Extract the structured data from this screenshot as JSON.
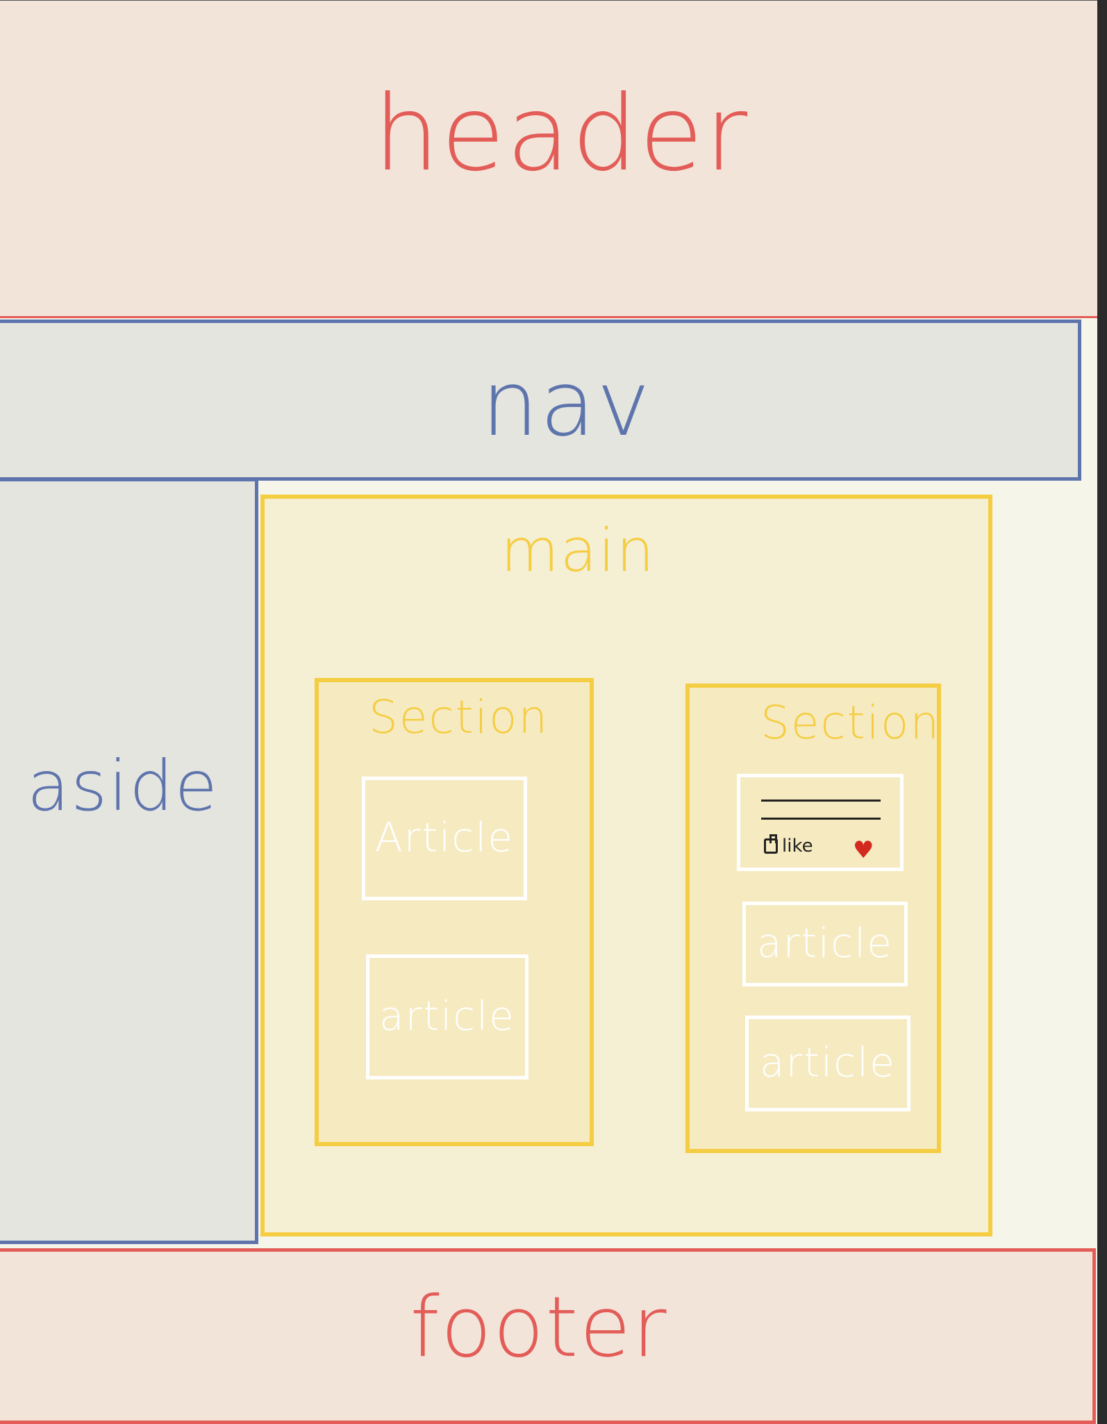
{
  "header": {
    "label": "header"
  },
  "nav": {
    "label": "nav"
  },
  "aside": {
    "label": "aside"
  },
  "main": {
    "label": "main",
    "sections": [
      {
        "label": "Section",
        "articles": [
          "Article",
          "article"
        ]
      },
      {
        "label": "Section",
        "card": {
          "like_label": "like"
        },
        "articles": [
          "article",
          "article"
        ]
      }
    ]
  },
  "footer": {
    "label": "footer"
  },
  "colors": {
    "header_footer": "#e35d58",
    "nav_aside": "#5e74ad",
    "main_section": "#f5cd43",
    "article": "#ffffff",
    "heart": "#d22a1f"
  }
}
